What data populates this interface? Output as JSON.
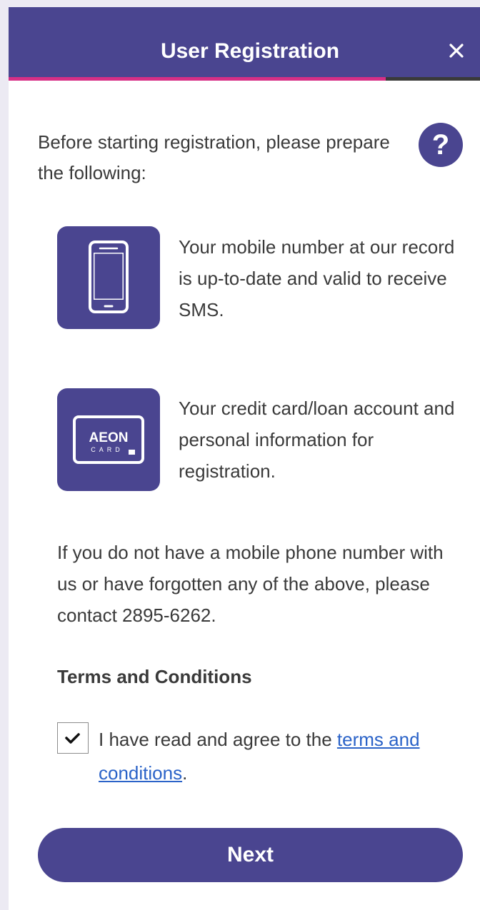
{
  "header": {
    "title": "User Registration",
    "close_icon": "close-icon",
    "progress_fraction": 0.8
  },
  "intro": {
    "text": "Before starting registration, please prepare the following:",
    "help_glyph": "?",
    "help_icon": "question-mark-icon"
  },
  "requirements": [
    {
      "icon": "mobile-phone-icon",
      "text": "Your mobile number at our record is up-to-date and valid to receive SMS."
    },
    {
      "icon": "aeon-card-icon",
      "card_brand": "AEON",
      "card_word": "CARD",
      "text": "Your credit card/loan account and personal information for registration."
    }
  ],
  "contact_note": "If you do not have a mobile phone number with us or have forgotten any of the above, please contact 2895-6262.",
  "terms": {
    "heading": "Terms and Conditions",
    "checked": true,
    "agree_prefix": "I have read and agree to the ",
    "link_text": "terms and conditions",
    "agree_suffix": "."
  },
  "next_button": {
    "label": "Next"
  },
  "colors": {
    "brand_purple": "#4a4590",
    "progress_accent": "#d62f86",
    "link_blue": "#2b63c8",
    "body_text": "#3a3a3a"
  }
}
